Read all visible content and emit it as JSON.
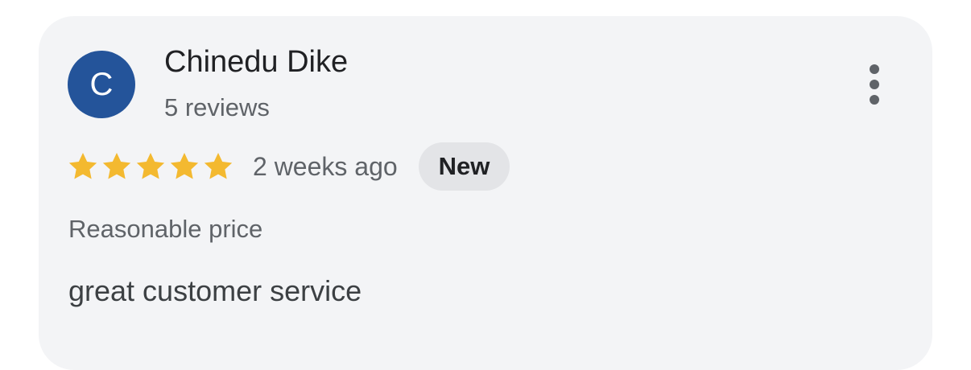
{
  "review": {
    "author": {
      "initial": "C",
      "name": "Chinedu Dike",
      "reviews_count": "5 reviews",
      "avatar_color": "#24549a"
    },
    "rating": {
      "stars": 5,
      "max_stars": 5,
      "star_color": "#f3b930"
    },
    "time": "2 weeks ago",
    "badge": "New",
    "attribute": "Reasonable price",
    "text": "great customer service",
    "more_icon": "more-vert-icon"
  }
}
